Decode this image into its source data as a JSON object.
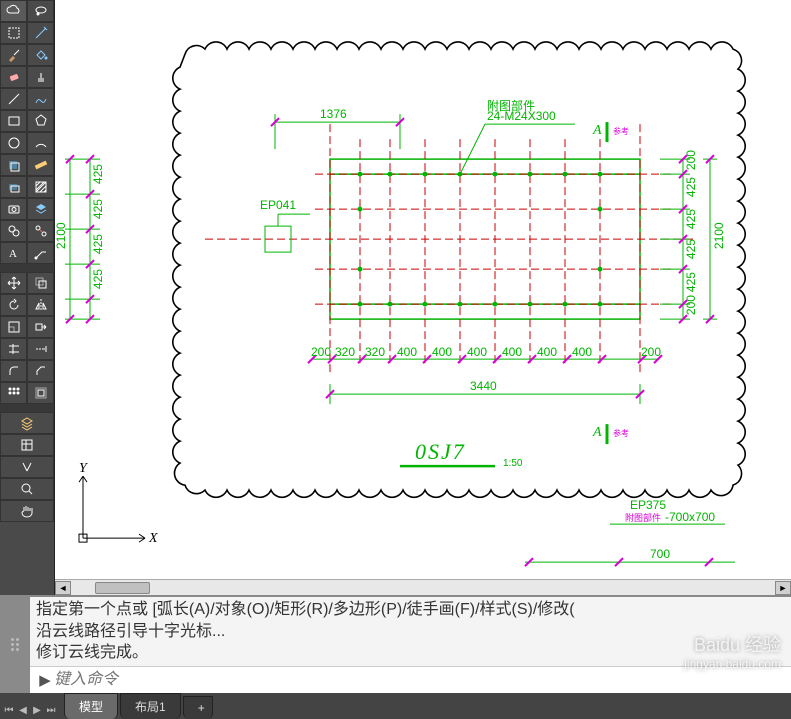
{
  "canvas": {
    "axis_x": "X",
    "axis_y": "Y"
  },
  "drawing": {
    "top_dim": "1376",
    "bolt_label": "24-M24X300",
    "section_mark": "A",
    "ep_label": "EP041",
    "left_height": "2100",
    "left_seg": [
      "425",
      "425",
      "425",
      "425"
    ],
    "right_height": "2100",
    "right_seg": [
      "200",
      "425",
      "425",
      "425",
      "425",
      "200"
    ],
    "bottom_seg": [
      "200",
      "320",
      "320",
      "400",
      "400",
      "400",
      "400",
      "400",
      "400",
      "200"
    ],
    "bottom_total": "3440",
    "title": "0SJ7",
    "scale": "1:50",
    "lower_ep": "EP375",
    "lower_note": "-700x700",
    "lower_dim": "700"
  },
  "command": {
    "line1": "指定第一个点或 [弧长(A)/对象(O)/矩形(R)/多边形(P)/徒手画(F)/样式(S)/修改(",
    "line2": "沿云线路径引导十字光标...",
    "line3": "修订云线完成。",
    "placeholder": "键入命令",
    "prompt": "▶"
  },
  "tabs": {
    "model": "模型",
    "layout1": "布局1",
    "add": "+"
  },
  "watermark": {
    "brand": "Baidu 经验",
    "url": "jingyan.baidu.com"
  },
  "icons": {
    "left_tools": [
      [
        "cloud",
        "lasso"
      ],
      [
        "rect-sel",
        "wand"
      ],
      [
        "brush",
        "fill"
      ],
      [
        "eraser",
        "stamp"
      ],
      [
        "line",
        "curve"
      ],
      [
        "rect",
        "poly"
      ],
      [
        "circle",
        "arc"
      ],
      [
        "crop",
        "measure"
      ],
      [
        "dim",
        "hatch"
      ],
      [
        "camera",
        "layer"
      ],
      [
        "group",
        "ungroup"
      ],
      [
        "text",
        "anno"
      ],
      [
        "gap",
        ""
      ],
      [
        "move",
        "copy"
      ],
      [
        "rotate",
        "mirror"
      ],
      [
        "scale",
        "stretch"
      ],
      [
        "trim",
        "extend"
      ],
      [
        "fillet",
        "chamfer"
      ],
      [
        "array",
        "offset"
      ],
      [
        "gap",
        ""
      ],
      [
        "layer-mgr",
        ""
      ],
      [
        "props",
        ""
      ],
      [
        "match",
        ""
      ],
      [
        "zoom",
        ""
      ],
      [
        "pan",
        ""
      ]
    ]
  }
}
